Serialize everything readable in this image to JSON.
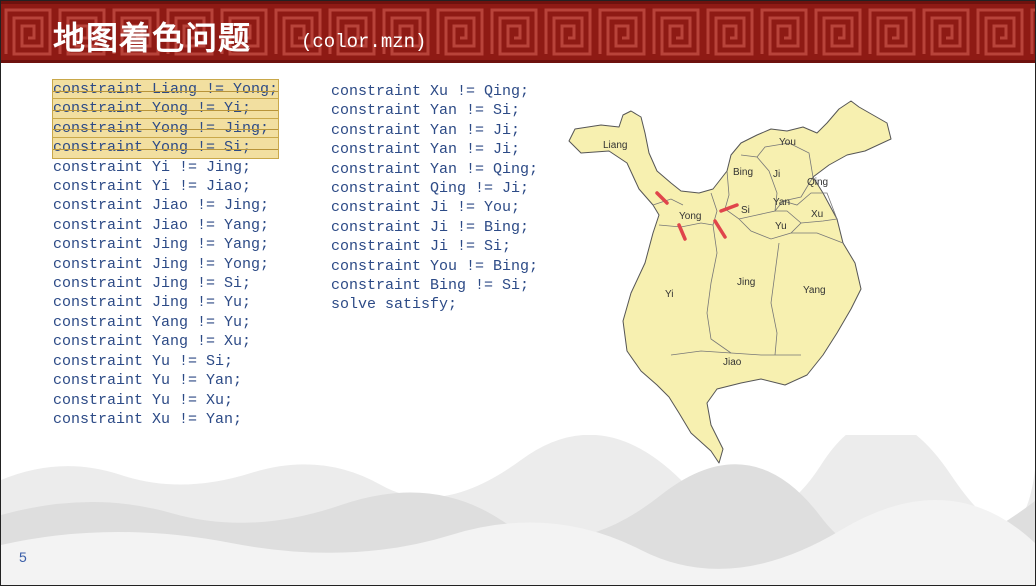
{
  "header": {
    "title": "地图着色问题",
    "subtitle": "(color.mzn)"
  },
  "code": {
    "column1": [
      "constraint Liang != Yong;",
      "constraint Yong != Yi;",
      "constraint Yong != Jing;",
      "constraint Yong != Si;",
      "constraint Yi != Jing;",
      "constraint Yi != Jiao;",
      "constraint Jiao != Jing;",
      "constraint Jiao != Yang;",
      "constraint Jing != Yang;",
      "constraint Jing != Yong;",
      "constraint Jing != Si;",
      "constraint Jing != Yu;",
      "constraint Yang != Yu;",
      "constraint Yang != Xu;",
      "constraint Yu != Si;",
      "constraint Yu != Yan;",
      "constraint Yu != Xu;",
      "constraint Xu != Yan;"
    ],
    "column2": [
      "constraint Xu != Qing;",
      "constraint Yan != Si;",
      "constraint Yan != Ji;",
      "constraint Yan != Ji;",
      "constraint Yan != Qing;",
      "constraint Qing != Ji;",
      "constraint Ji != You;",
      "constraint Ji != Bing;",
      "constraint Ji != Si;",
      "constraint You != Bing;",
      "constraint Bing != Si;",
      "solve satisfy;"
    ],
    "highlighted_count": 4
  },
  "map": {
    "regions": {
      "liang": "Liang",
      "yong": "Yong",
      "yi": "Yi",
      "jing": "Jing",
      "yang": "Yang",
      "jiao": "Jiao",
      "si": "Si",
      "bing": "Bing",
      "ji": "Ji",
      "you": "You",
      "qing": "Qing",
      "yan": "Yan",
      "xu": "Xu",
      "yu": "Yu"
    },
    "fill_color": "#f7f0b0",
    "border_color": "#555555",
    "marker_color": "#e0454b"
  },
  "footer": {
    "page_number": "5"
  }
}
